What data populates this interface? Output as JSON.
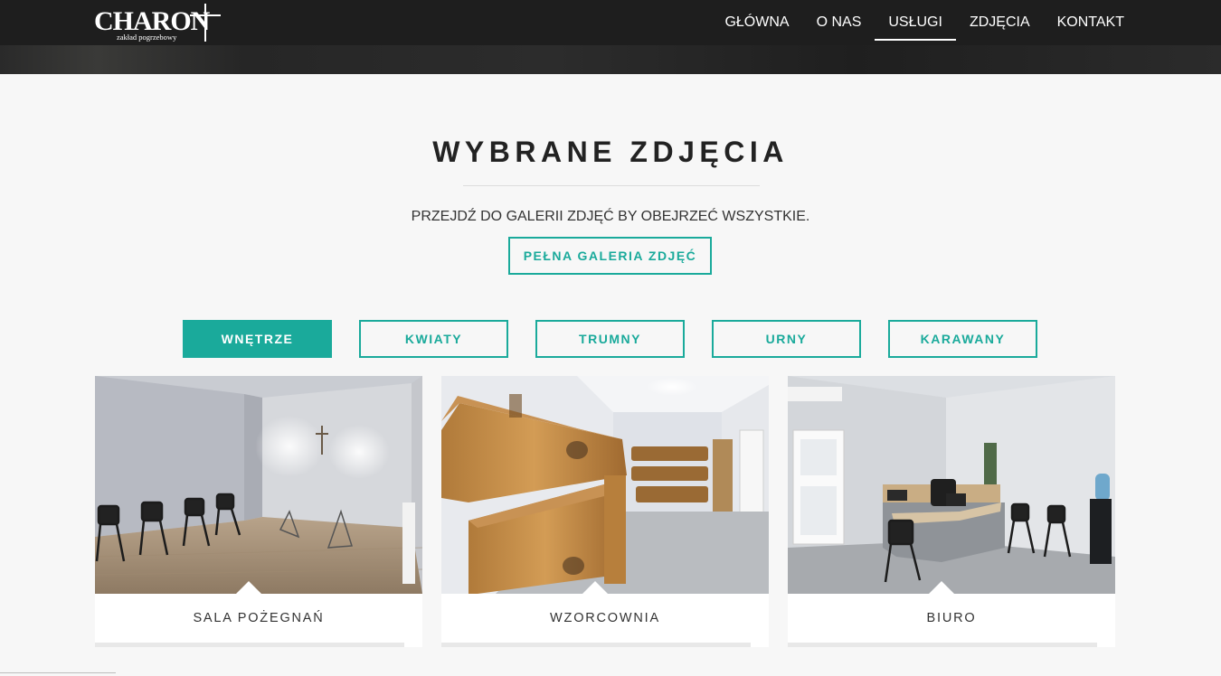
{
  "brand": {
    "name": "CHARON",
    "tagline": "zakład pogrzebowy"
  },
  "nav": {
    "items": [
      {
        "label": "GŁÓWNA"
      },
      {
        "label": "O NAS"
      },
      {
        "label": "USŁUGI",
        "active": true
      },
      {
        "label": "ZDJĘCIA"
      },
      {
        "label": "KONTAKT"
      }
    ]
  },
  "section": {
    "title": "WYBRANE ZDJĘCIA",
    "subtitle": "PRZEJDŹ DO GALERII ZDJĘĆ BY OBEJRZEĆ WSZYSTKIE.",
    "gallery_button": "PEŁNA GALERIA ZDJĘĆ"
  },
  "filters": [
    {
      "label": "WNĘTRZE",
      "active": true
    },
    {
      "label": "KWIATY"
    },
    {
      "label": "TRUMNY"
    },
    {
      "label": "URNY"
    },
    {
      "label": "KARAWANY"
    }
  ],
  "cards": [
    {
      "caption": "SALA POŻEGNAŃ"
    },
    {
      "caption": "WZORCOWNIA"
    },
    {
      "caption": "BIURO"
    }
  ],
  "colors": {
    "accent": "#1aaa9b",
    "header": "#1e1e1e",
    "page": "#f7f7f7"
  }
}
